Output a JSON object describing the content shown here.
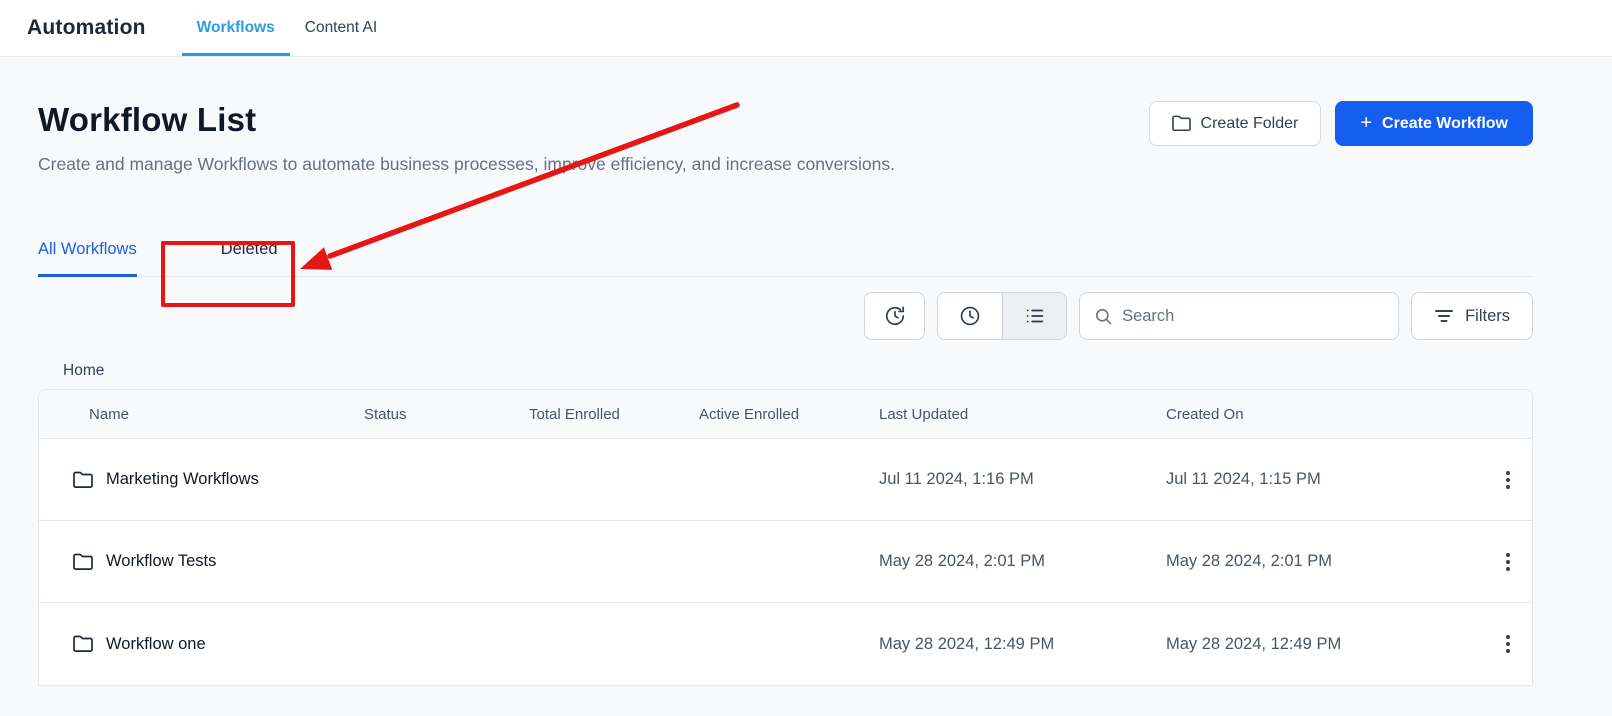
{
  "topnav": {
    "title": "Automation",
    "tabs": [
      {
        "label": "Workflows",
        "active": true
      },
      {
        "label": "Content AI",
        "active": false
      }
    ]
  },
  "header": {
    "title": "Workflow List",
    "description": "Create and manage Workflows to automate business processes, improve efficiency, and increase conversions.",
    "create_folder_label": "Create Folder",
    "create_workflow_label": "Create Workflow",
    "plus_glyph": "+"
  },
  "workflow_tabs": [
    {
      "label": "All Workflows",
      "active": true
    },
    {
      "label": "Deleted",
      "active": false,
      "highlighted_by_annotation": true
    }
  ],
  "toolbar": {
    "icon_buttons": [
      "history-clock-icon",
      "clock-icon",
      "list-view-icon"
    ],
    "selected_view": "list",
    "search_placeholder": "Search",
    "search_value": "",
    "filters_label": "Filters"
  },
  "breadcrumb": "Home",
  "table": {
    "columns": [
      "Name",
      "Status",
      "Total Enrolled",
      "Active Enrolled",
      "Last Updated",
      "Created On"
    ],
    "rows": [
      {
        "name": "Marketing Workflows",
        "status": "",
        "total_enrolled": "",
        "active_enrolled": "",
        "last_updated": "Jul 11 2024, 1:16 PM",
        "created_on": "Jul 11 2024, 1:15 PM"
      },
      {
        "name": "Workflow Tests",
        "status": "",
        "total_enrolled": "",
        "active_enrolled": "",
        "last_updated": "May 28 2024, 2:01 PM",
        "created_on": "May 28 2024, 2:01 PM"
      },
      {
        "name": "Workflow one",
        "status": "",
        "total_enrolled": "",
        "active_enrolled": "",
        "last_updated": "May 28 2024, 12:49 PM",
        "created_on": "May 28 2024, 12:49 PM"
      }
    ]
  },
  "annotation": {
    "type": "red box around Deleted tab with arrow pointing to it",
    "color": "#e81515"
  },
  "colors": {
    "primary_blue": "#155eef",
    "nav_active_blue": "#2b9be3",
    "tab_active_blue": "#1a5ee8",
    "annotation_red": "#e81515",
    "page_background": "#f8f9fb"
  }
}
